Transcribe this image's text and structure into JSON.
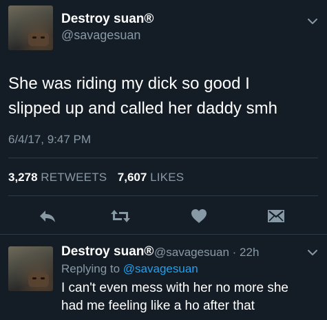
{
  "main_tweet": {
    "display_name": "Destroy suan®",
    "handle": "@savagesuan",
    "text_line1": "She was riding my dick so good I",
    "text_line2": "slipped up and called her daddy smh",
    "timestamp": "6/4/17, 9:47 PM",
    "stats": {
      "retweets_count": "3,278",
      "retweets_label": "RETWEETS",
      "likes_count": "7,607",
      "likes_label": "LIKES"
    },
    "actions": [
      "reply-icon",
      "retweet-icon",
      "like-icon",
      "dm-icon"
    ]
  },
  "reply_tweet": {
    "display_name": "Destroy suan®",
    "handle_time": "@savagesuan · 22h",
    "replying_prefix": "Replying to",
    "replying_handle": "@savagesuan",
    "text_line1": "I can't even mess with her no more she",
    "text_line2": "had me feeling like a ho after that"
  },
  "colors": {
    "background": "#141d26",
    "text": "#ffffff",
    "muted": "#8899a6",
    "link": "#1da1f2",
    "divider": "#2b3a48"
  }
}
